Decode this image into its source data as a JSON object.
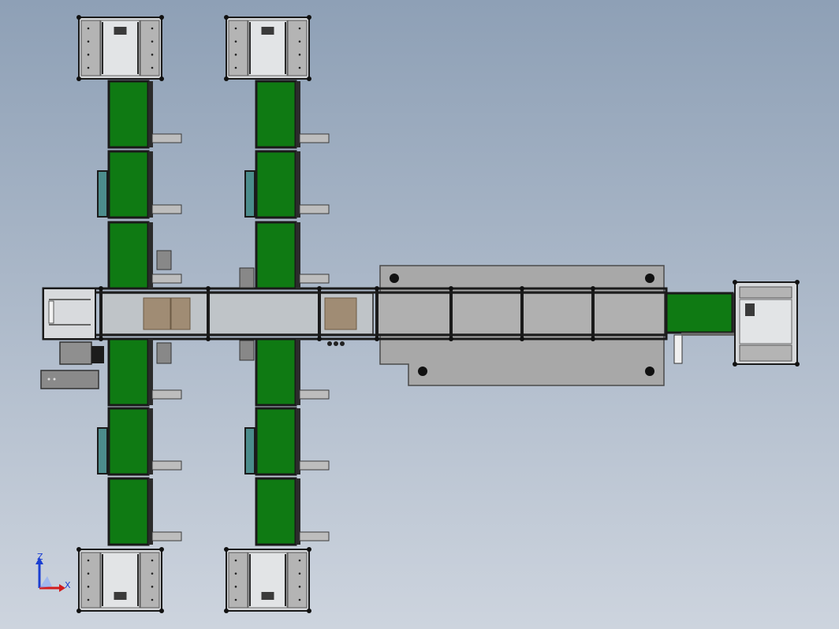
{
  "viewport": {
    "background_top": "#8ea0b6",
    "background_bottom": "#cdd4de"
  },
  "colors": {
    "belt_green": "#0f7a13",
    "frame_dark": "#1a1a1a",
    "frame_gray": "#9c9c9c",
    "panel_gray": "#b4b4b4",
    "plate_gray": "#a8a8a8",
    "box_brown": "#a08c74",
    "glass_teal": "#4c8c8c",
    "axis_x": "#d21b1b",
    "axis_y": "#2aa52a",
    "axis_z": "#1b3fd2"
  },
  "triad": {
    "z_label": "Z",
    "x_label": "X",
    "icon": "coordinate-triad-icon"
  }
}
